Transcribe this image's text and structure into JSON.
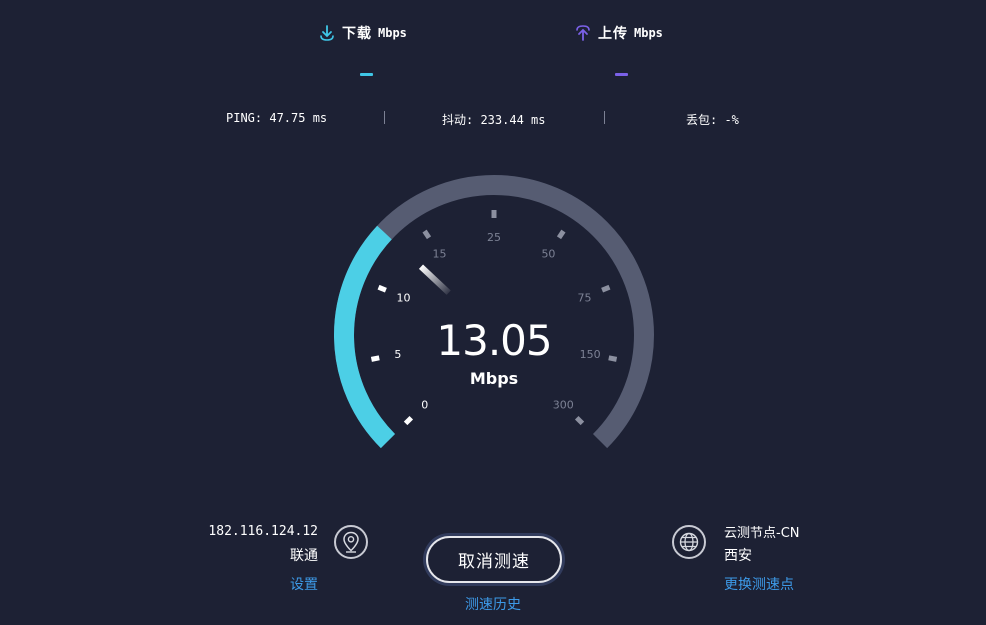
{
  "header": {
    "download": {
      "label": "下载",
      "unit": "Mbps",
      "icon": "download-arrow-icon",
      "color": "#3fc6e6"
    },
    "upload": {
      "label": "上传",
      "unit": "Mbps",
      "icon": "upload-arrow-icon",
      "color": "#7b61e8"
    }
  },
  "stats": {
    "ping": "PING: 47.75 ms",
    "jitter": "抖动: 233.44 ms",
    "loss": "丢包: -%"
  },
  "gauge": {
    "value": "13.05",
    "unit": "Mbps",
    "current_mbps": 13.05,
    "ticks": [
      "0",
      "5",
      "10",
      "15",
      "25",
      "50",
      "75",
      "150",
      "300"
    ],
    "active_color": "#4ccfe6",
    "track_color": "#565c72"
  },
  "client": {
    "ip": "182.116.124.12",
    "isp": "联通",
    "settings_label": "设置",
    "icon": "location-pin-icon"
  },
  "actions": {
    "cancel_label": "取消测速",
    "history_label": "测速历史"
  },
  "server": {
    "name": "云测节点-CN",
    "city": "西安",
    "change_label": "更换测速点",
    "icon": "globe-icon"
  }
}
